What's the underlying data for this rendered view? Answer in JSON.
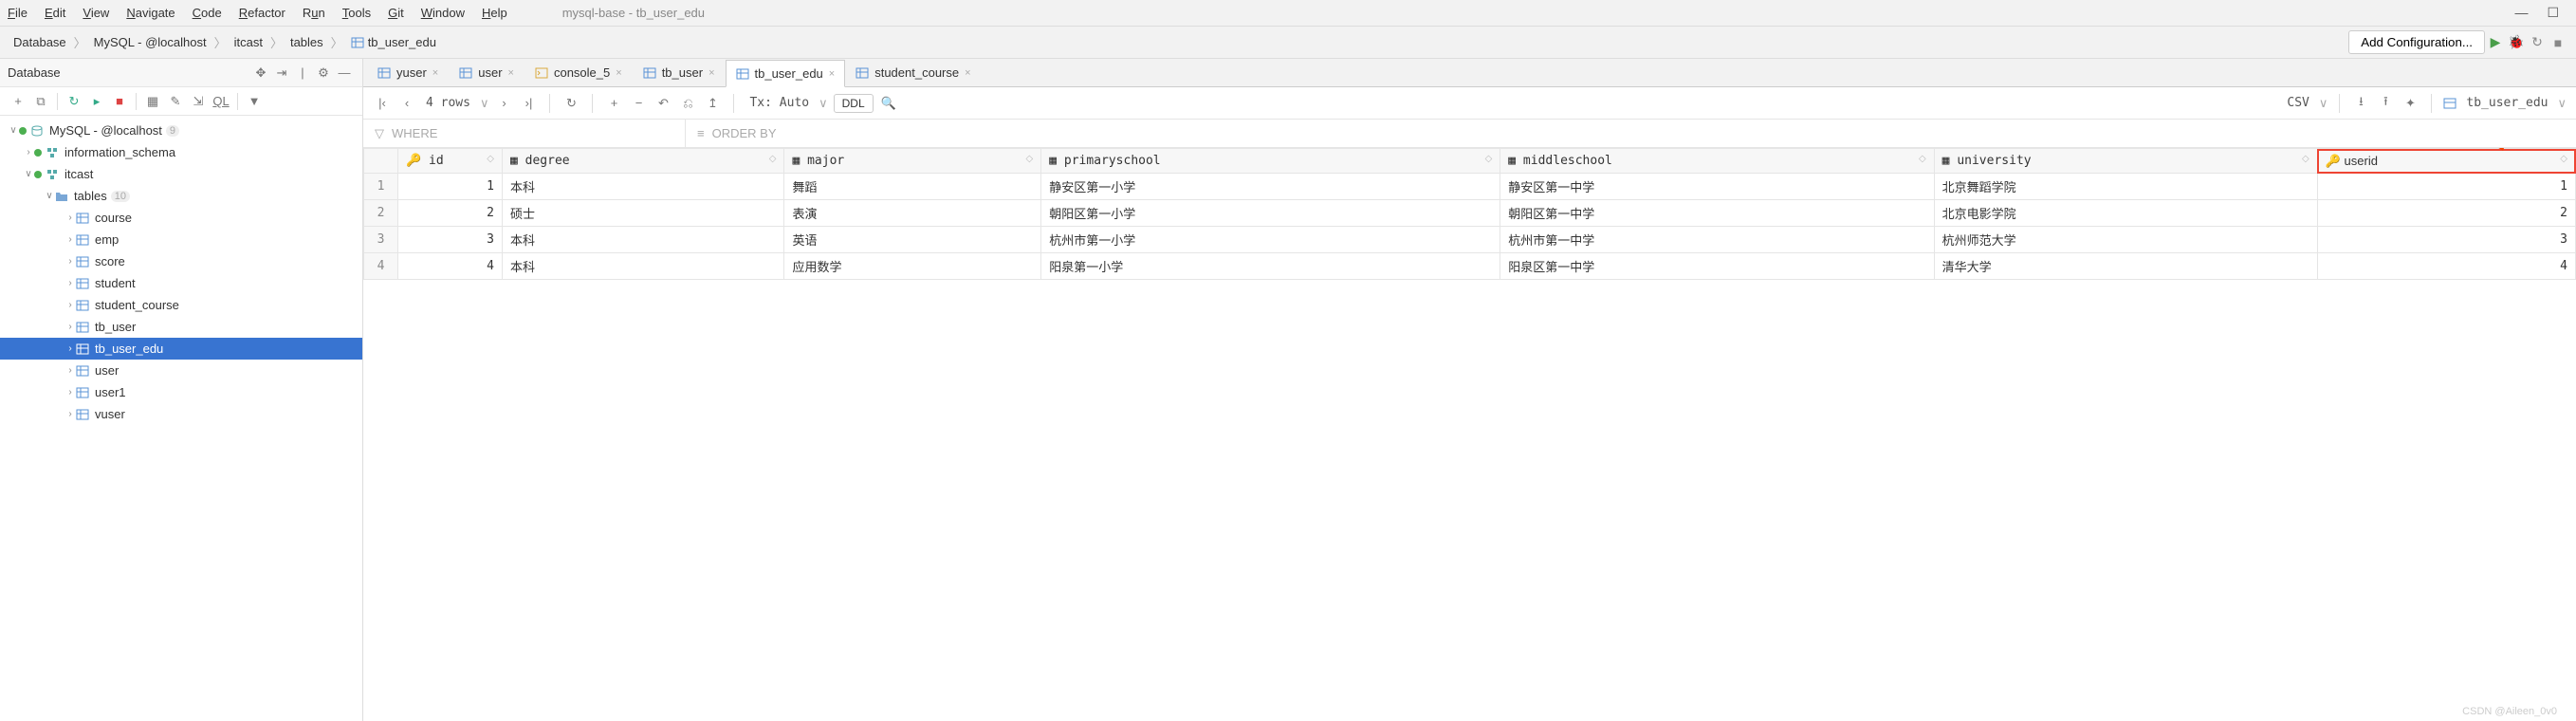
{
  "window": {
    "title": "mysql-base - tb_user_edu",
    "menus": [
      "File",
      "Edit",
      "View",
      "Navigate",
      "Code",
      "Refactor",
      "Run",
      "Tools",
      "Git",
      "Window",
      "Help"
    ]
  },
  "breadcrumbs": [
    "Database",
    "MySQL - @localhost",
    "itcast",
    "tables",
    "tb_user_edu"
  ],
  "add_config": "Add Configuration...",
  "sidebar": {
    "title": "Database",
    "tree": {
      "root": {
        "label": "MySQL - @localhost",
        "count": "9"
      },
      "schemas": [
        "information_schema"
      ],
      "db": {
        "label": "itcast"
      },
      "tables_label": "tables",
      "tables_count": "10",
      "tables": [
        "course",
        "emp",
        "score",
        "student",
        "student_course",
        "tb_user",
        "tb_user_edu",
        "user",
        "user1",
        "vuser"
      ],
      "selected": "tb_user_edu"
    }
  },
  "tabs": [
    {
      "label": "yuser",
      "icon": "table"
    },
    {
      "label": "user",
      "icon": "table"
    },
    {
      "label": "console_5",
      "icon": "console"
    },
    {
      "label": "tb_user",
      "icon": "table"
    },
    {
      "label": "tb_user_edu",
      "icon": "table",
      "active": true
    },
    {
      "label": "student_course",
      "icon": "table"
    }
  ],
  "data_toolbar": {
    "rows": "4 rows",
    "tx": "Tx: Auto",
    "ddl": "DDL",
    "csv": "CSV",
    "target": "tb_user_edu"
  },
  "filter": {
    "where": "WHERE",
    "orderby": "ORDER BY"
  },
  "columns": [
    "id",
    "degree",
    "major",
    "primaryschool",
    "middleschool",
    "university",
    "userid"
  ],
  "rows": [
    {
      "n": "1",
      "id": "1",
      "degree": "本科",
      "major": "舞蹈",
      "primaryschool": "静安区第一小学",
      "middleschool": "静安区第一中学",
      "university": "北京舞蹈学院",
      "userid": "1"
    },
    {
      "n": "2",
      "id": "2",
      "degree": "硕士",
      "major": "表演",
      "primaryschool": "朝阳区第一小学",
      "middleschool": "朝阳区第一中学",
      "university": "北京电影学院",
      "userid": "2"
    },
    {
      "n": "3",
      "id": "3",
      "degree": "本科",
      "major": "英语",
      "primaryschool": "杭州市第一小学",
      "middleschool": "杭州市第一中学",
      "university": "杭州师范大学",
      "userid": "3"
    },
    {
      "n": "4",
      "id": "4",
      "degree": "本科",
      "major": "应用数学",
      "primaryschool": "阳泉第一小学",
      "middleschool": "阳泉区第一中学",
      "university": "清华大学",
      "userid": "4"
    }
  ],
  "watermark": "CSDN @Aileen_0v0"
}
